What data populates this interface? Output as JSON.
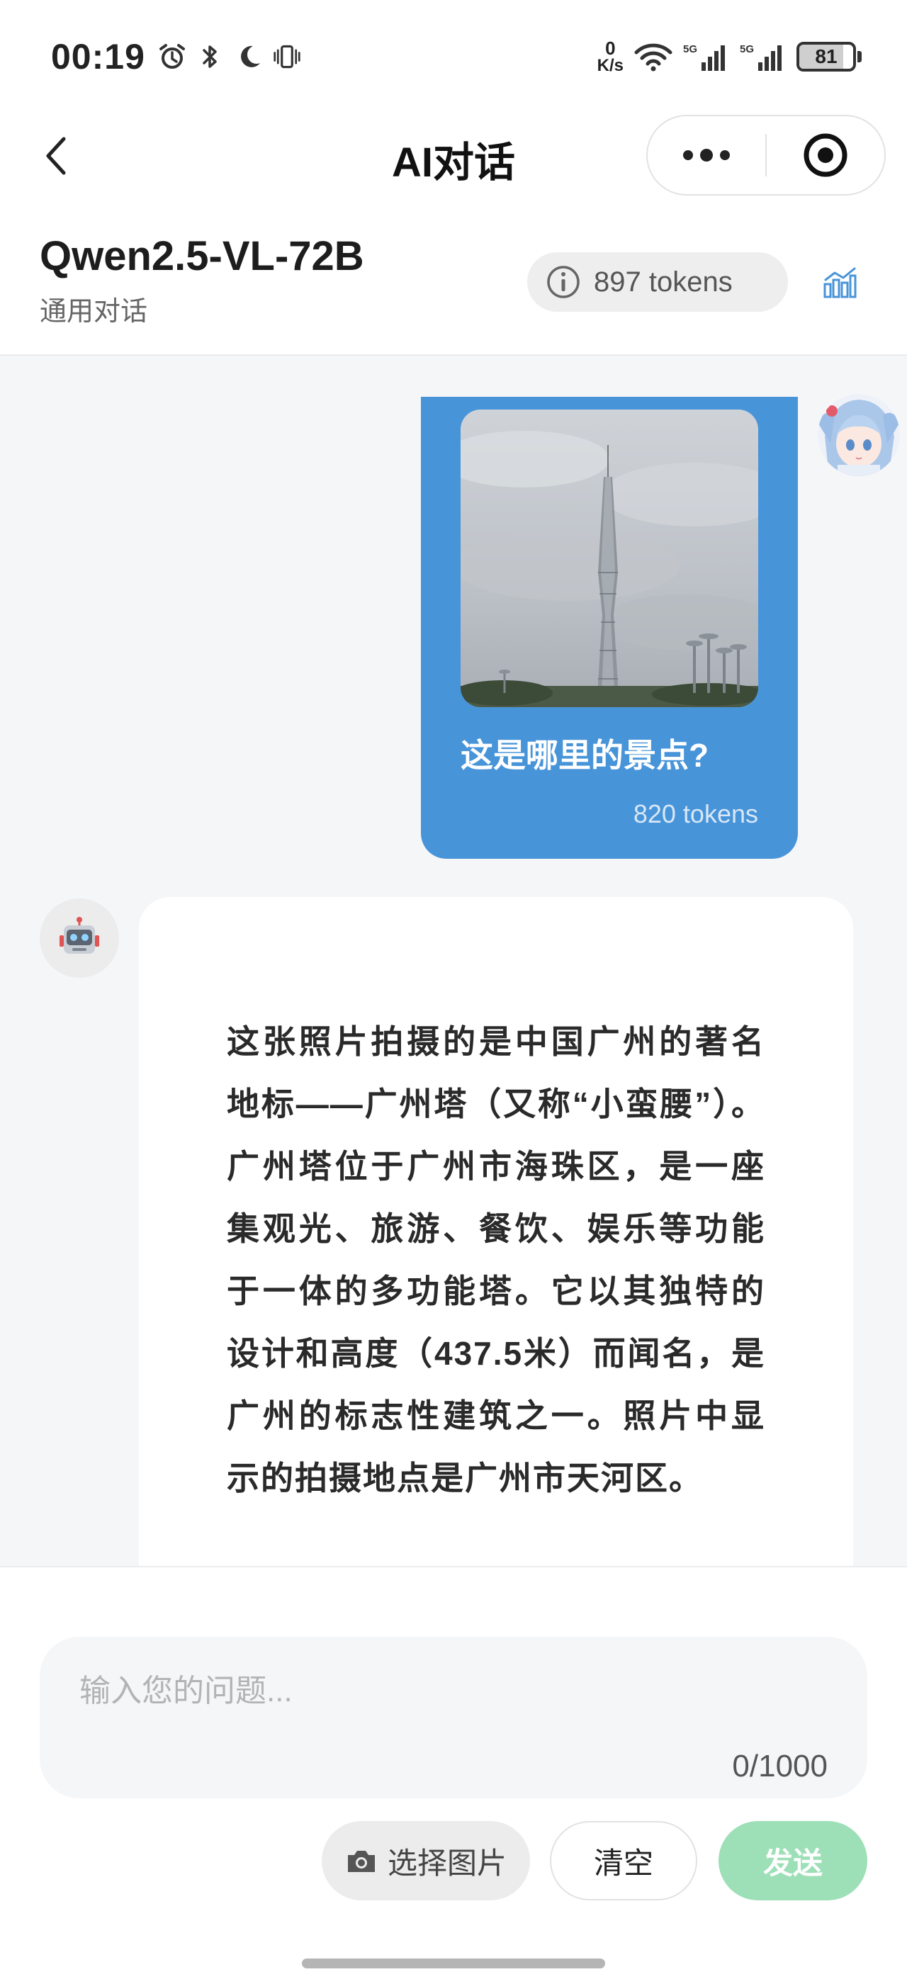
{
  "status_bar": {
    "time": "00:19",
    "net_speed_value": "0",
    "net_speed_unit": "K/s",
    "battery": "81",
    "battery_fraction": 0.81,
    "icons": [
      "alarm-icon",
      "bluetooth-icon",
      "moon-icon",
      "vibrate-icon",
      "wifi-icon",
      "signal-5g-icon",
      "signal-5g-icon"
    ]
  },
  "nav": {
    "title": "AI对话",
    "icons": [
      "back-icon",
      "more-icon",
      "record-icon"
    ]
  },
  "model": {
    "name": "Qwen2.5-VL-72B",
    "subtitle": "通用对话",
    "token_count": "897 tokens",
    "icons": [
      "info-icon",
      "stats-icon"
    ]
  },
  "messages": {
    "user": {
      "text": "这是哪里的景点?",
      "tokens": "820 tokens"
    },
    "assistant": {
      "avatar_icon": "robot-icon",
      "text": "这张照片拍摄的是中国广州的著名地标——广州塔（又称“小蛮腰”）。广州塔位于广州市海珠区，是一座集观光、旅游、餐饮、娱乐等功能于一体的多功能塔。它以其独特的设计和高度（437.5米）而闻名，是广州的标志性建筑之一。照片中显示的拍摄地点是广州市天河区。"
    }
  },
  "input": {
    "placeholder": "输入您的问题...",
    "value": "",
    "char_count": "0/1000"
  },
  "actions": {
    "choose_image": "选择图片",
    "clear": "清空",
    "send": "发送"
  },
  "colors": {
    "user_bubble": "#4894d9",
    "send_button": "#9ddfb7",
    "chat_background": "#f5f6f8",
    "accent": "#4894d9"
  }
}
